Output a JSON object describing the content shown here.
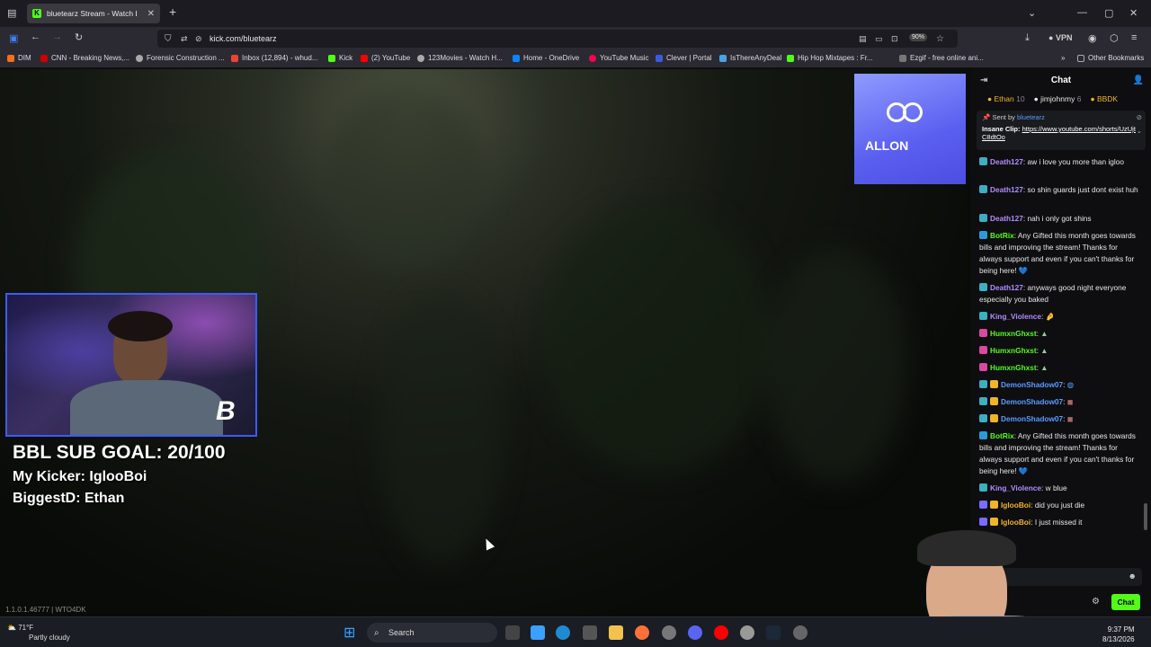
{
  "browser": {
    "tab_title": "bluetearz Stream - Watch L",
    "url": "kick.com/bluetearz",
    "zoom": "90%",
    "vpn_label": "VPN",
    "bookmarks": [
      "DIM",
      "CNN - Breaking News,...",
      "Forensic Construction ...",
      "Inbox (12,894) - whud...",
      "Kick",
      "(2) YouTube",
      "123Movies - Watch H...",
      "Home - OneDrive",
      "YouTube Music",
      "Clever | Portal",
      "IsThereAnyDeal",
      "Hip Hop Mixtapes : Fr...",
      "Ezgif - free online ani..."
    ],
    "other_bookmarks": "Other Bookmarks"
  },
  "stream": {
    "goal_title": "BBL SUB GOAL: 20/100",
    "kicker": "My Kicker: IglooBoi",
    "biggest": "BiggestD: Ethan",
    "version": "1.1.0.1.46777 | WTO4DK",
    "ad_text": "ALLON"
  },
  "chat": {
    "title": "Chat",
    "leaderboard": [
      {
        "name": "Ethan",
        "count": "10",
        "color": "#f0b429"
      },
      {
        "name": "jimjohnmy",
        "count": "6",
        "color": "#e8e8e8"
      },
      {
        "name": "BBDK",
        "count": "",
        "color": "#f0b429"
      }
    ],
    "pinned_sent_by": "Sent by",
    "pinned_user": "bluetearz",
    "pinned_label": "Insane Clip:",
    "pinned_link": "https://www.youtube.com/shorts/UzUjtC8dtOo",
    "messages": [
      {
        "user": "Death127",
        "color": "#b18cff",
        "text": "aw i love you more than igloo"
      },
      {
        "user": "Death127",
        "color": "#b18cff",
        "text": "so shin guards just dont exist huh"
      },
      {
        "user": "Death127",
        "color": "#b18cff",
        "text": "nah i only got shins"
      },
      {
        "user": "BotRix",
        "color": "#53fc18",
        "text": "Any Gifted this month goes towards bills and improving the stream! Thanks for always support and even if you can't thanks for being here!"
      },
      {
        "user": "Death127",
        "color": "#b18cff",
        "text": "anyways good night everyone especially you baked"
      },
      {
        "user": "King_Violence",
        "color": "#b18cff",
        "text": ""
      },
      {
        "user": "HumxnGhxst",
        "color": "#53fc18",
        "text": ""
      },
      {
        "user": "HumxnGhxst",
        "color": "#53fc18",
        "text": ""
      },
      {
        "user": "HumxnGhxst",
        "color": "#53fc18",
        "text": ""
      },
      {
        "user": "DemonShadow07",
        "color": "#5b9bff",
        "text": ""
      },
      {
        "user": "DemonShadow07",
        "color": "#5b9bff",
        "text": ""
      },
      {
        "user": "DemonShadow07",
        "color": "#5b9bff",
        "text": ""
      },
      {
        "user": "BotRix",
        "color": "#53fc18",
        "text": "Any Gifted this month goes towards bills and improving the stream! Thanks for always support and even if you can't thanks for being here!"
      },
      {
        "user": "King_Violence",
        "color": "#b18cff",
        "text": "w blue"
      },
      {
        "user": "IglooBoi",
        "color": "#f0b429",
        "text": "did you just die"
      },
      {
        "user": "IglooBoi",
        "color": "#f0b429",
        "text": "I just missed it"
      }
    ],
    "send_label": "Chat"
  },
  "taskbar": {
    "temp": "71°F",
    "weather": "Partly cloudy",
    "search": "Search",
    "time": "9:37 PM",
    "date": "8/13/2026"
  }
}
